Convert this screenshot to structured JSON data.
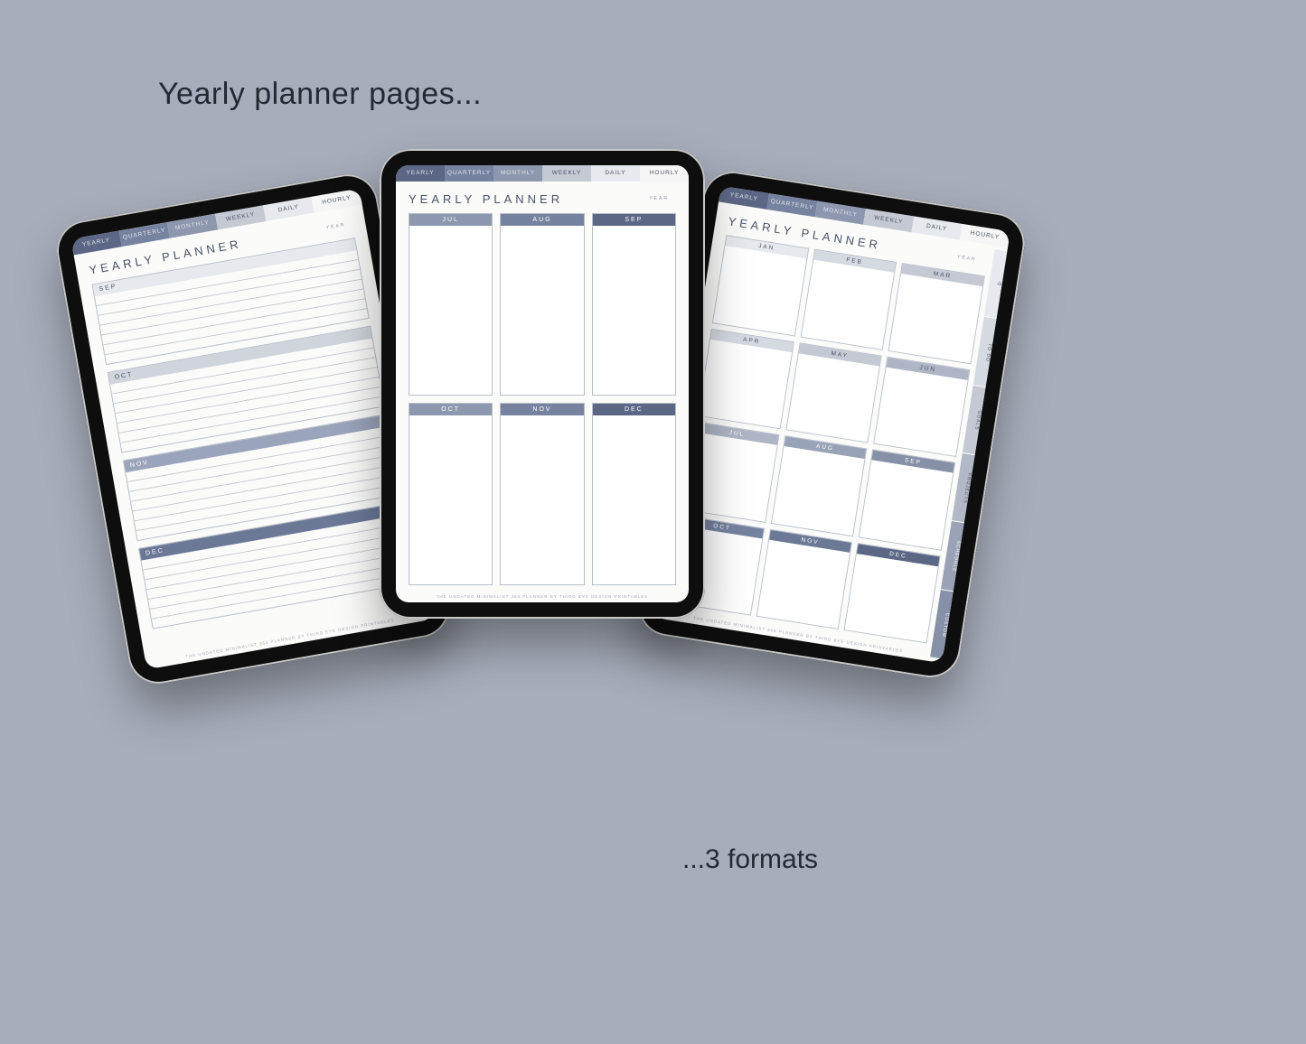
{
  "heading": "Yearly planner pages...",
  "footer": "...3 formats",
  "tabs": [
    "YEARLY",
    "QUARTERLY",
    "MONTHLY",
    "WEEKLY",
    "DAILY",
    "HOURLY"
  ],
  "sidetabs": [
    "Q",
    "TO DO",
    "GOALS",
    "PROJECTS",
    "SCHEDULE",
    "CUSTOM"
  ],
  "page_title": "YEARLY PLANNER",
  "year_label": "YEAR",
  "footnote": "THE UNDATED MINIMALIST 365 PLANNER BY THIRD EYE DESIGN PRINTABLES",
  "format1_months": [
    "SEP",
    "OCT",
    "NOV",
    "DEC"
  ],
  "format2_months": [
    "JUL",
    "AUG",
    "SEP",
    "OCT",
    "NOV",
    "DEC"
  ],
  "format3_months": [
    "JAN",
    "FEB",
    "MAR",
    "APR",
    "MAY",
    "JUN",
    "JUL",
    "AUG",
    "SEP",
    "OCT",
    "NOV",
    "DEC"
  ]
}
